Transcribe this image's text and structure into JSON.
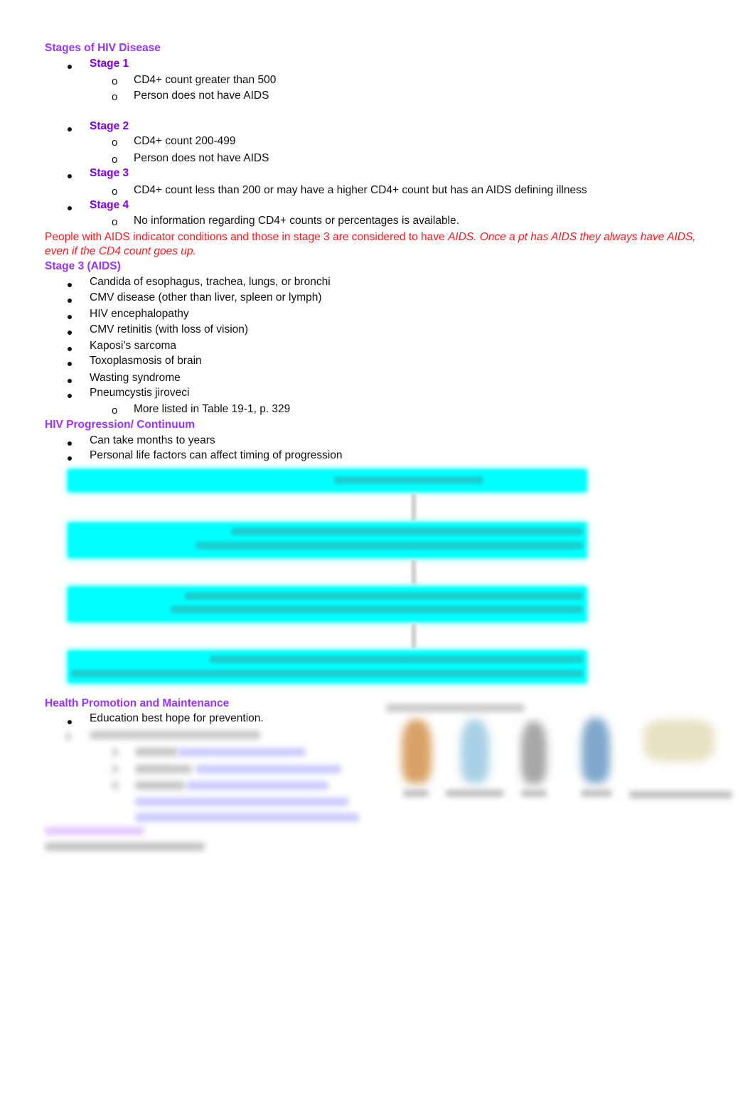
{
  "document": {
    "stages_section": {
      "heading": "Stages of HIV Disease",
      "stages": [
        {
          "label": "Stage 1",
          "details": [
            "CD4+ count greater than 500",
            "Person does not have AIDS"
          ]
        },
        {
          "label": "Stage 2",
          "details": [
            "CD4+ count 200-499",
            "Person does not have AIDS"
          ]
        },
        {
          "label": "Stage 3",
          "details": [
            "CD4+ count less than 200 or may have a higher CD4+ count but has an AIDS defining illness"
          ]
        },
        {
          "label": "Stage 4",
          "details": [
            "No information regarding CD4+ counts or percentages is available."
          ]
        }
      ],
      "sub_bullet_glyph": "o"
    },
    "note": {
      "normal": "People with AIDS indicator conditions and those in stage 3 are considered to have ",
      "italic_line1": "AIDS. Once a pt has AIDS they always have AIDS,",
      "italic_line2": "even if the CD4 count goes up.",
      "color": "#ff1a1a"
    },
    "aids_section": {
      "heading": "Stage 3 (AIDS)",
      "items": [
        "Candida of esophagus, trachea, lungs, or bronchi",
        "CMV disease (other than liver, spleen or lymph)",
        "HIV encephalopathy",
        "CMV retinitis (with loss of vision)",
        "Kaposi’s sarcoma",
        "Toxoplasmosis of brain",
        "Wasting syndrome",
        "Pneumcystis jiroveci"
      ],
      "sub_item": "More listed in Table 19-1, p. 329"
    },
    "progression_section": {
      "heading": "HIV Progression/ Continuum",
      "items": [
        "Can take months to years",
        "Personal life factors can affect timing of progression"
      ],
      "flowchart": {
        "box_color": "#00ffff",
        "box_count": 4,
        "text_obscured": true
      }
    },
    "health_section": {
      "heading": "Health Promotion and Maintenance",
      "items": [
        "Education best hope for prevention."
      ],
      "remaining_content_obscured": true
    },
    "colors": {
      "section_heading": "#9933ff",
      "stage_label": "#7f00df",
      "body_text": "#111111",
      "note_text": "#ff1a1a"
    }
  }
}
